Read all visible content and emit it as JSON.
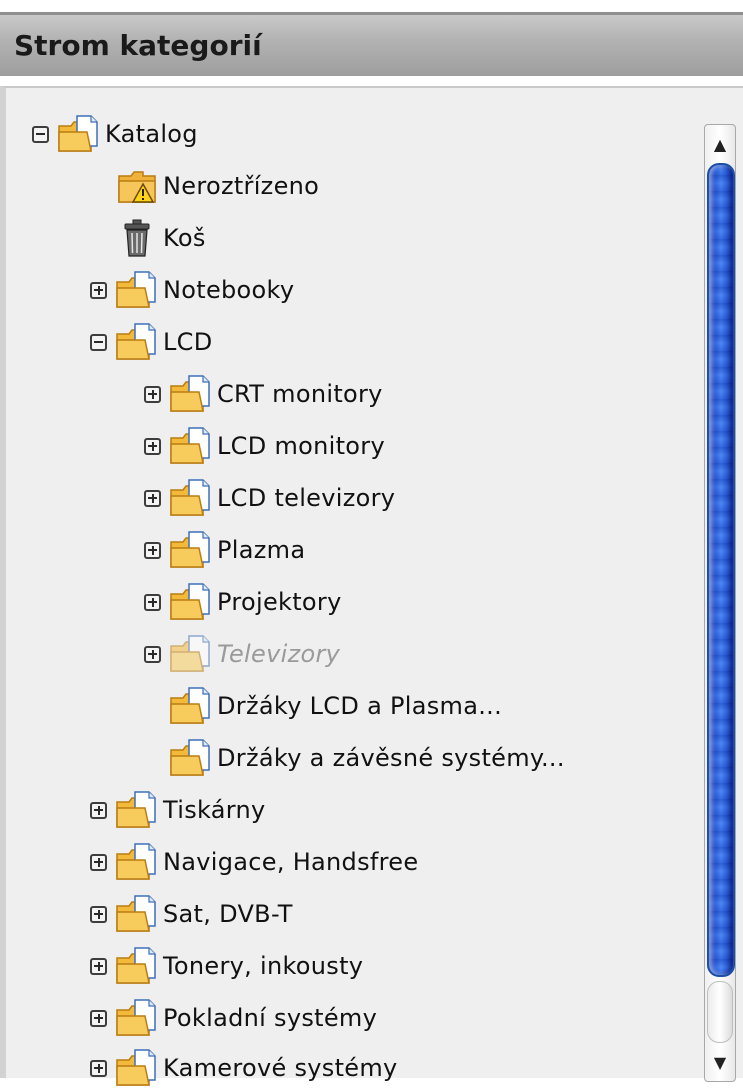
{
  "panel": {
    "title": "Strom kategorií"
  },
  "tree": {
    "nodes": [
      {
        "label": "Katalog",
        "toggle": "minus",
        "icon": "folder-icon",
        "disabled": false
      },
      {
        "label": "Neroztřízeno",
        "toggle": "none",
        "icon": "warning-folder-icon",
        "disabled": false
      },
      {
        "label": "Koš",
        "toggle": "none",
        "icon": "trash-icon",
        "disabled": false
      },
      {
        "label": "Notebooky",
        "toggle": "plus",
        "icon": "folder-icon",
        "disabled": false
      },
      {
        "label": "LCD",
        "toggle": "minus",
        "icon": "folder-icon",
        "disabled": false
      },
      {
        "label": "CRT monitory",
        "toggle": "plus",
        "icon": "folder-icon",
        "disabled": false
      },
      {
        "label": "LCD monitory",
        "toggle": "plus",
        "icon": "folder-icon",
        "disabled": false
      },
      {
        "label": "LCD televizory",
        "toggle": "plus",
        "icon": "folder-icon",
        "disabled": false
      },
      {
        "label": "Plazma",
        "toggle": "plus",
        "icon": "folder-icon",
        "disabled": false
      },
      {
        "label": "Projektory",
        "toggle": "plus",
        "icon": "folder-icon",
        "disabled": false
      },
      {
        "label": "Televizory",
        "toggle": "plus",
        "icon": "folder-icon",
        "disabled": true
      },
      {
        "label": "Držáky LCD a Plasma...",
        "toggle": "none",
        "icon": "folder-icon",
        "disabled": false
      },
      {
        "label": "Držáky a závěsné systémy...",
        "toggle": "none",
        "icon": "folder-icon",
        "disabled": false
      },
      {
        "label": "Tiskárny",
        "toggle": "plus",
        "icon": "folder-icon",
        "disabled": false
      },
      {
        "label": "Navigace, Handsfree",
        "toggle": "plus",
        "icon": "folder-icon",
        "disabled": false
      },
      {
        "label": "Sat, DVB-T",
        "toggle": "plus",
        "icon": "folder-icon",
        "disabled": false
      },
      {
        "label": "Tonery, inkousty",
        "toggle": "plus",
        "icon": "folder-icon",
        "disabled": false
      },
      {
        "label": "Pokladní systémy",
        "toggle": "plus",
        "icon": "folder-icon",
        "disabled": false
      },
      {
        "label": "Kamerové systémy",
        "toggle": "plus",
        "icon": "folder-icon",
        "disabled": false
      }
    ]
  },
  "scrollbar": {
    "up_arrow": "▲",
    "down_arrow": "▼"
  },
  "colors": {
    "thumb": "#3f78dc",
    "header": "#b3b3b3",
    "body_bg": "#efefef",
    "disabled_text": "#9a9a9a"
  }
}
